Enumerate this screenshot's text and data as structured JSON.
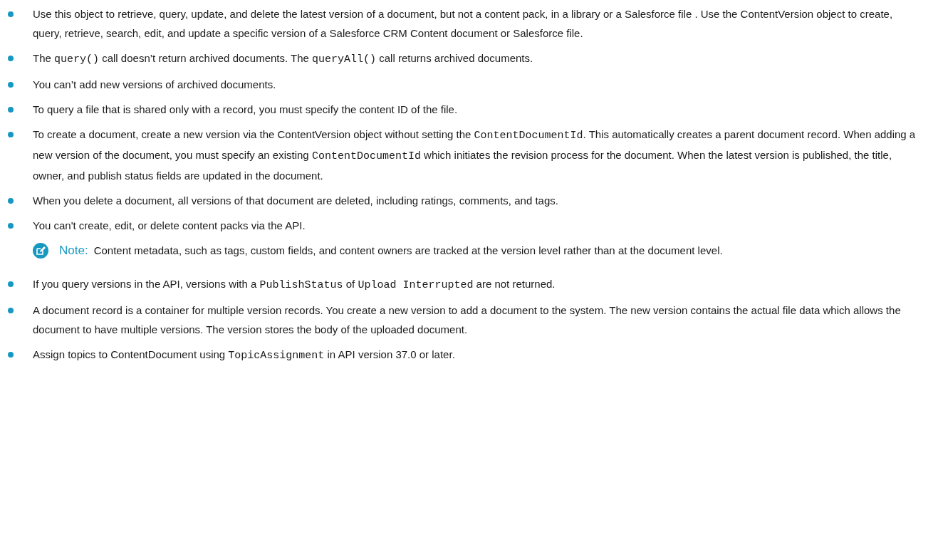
{
  "items": [
    {
      "kind": "bullet",
      "parts": [
        {
          "kind": "text",
          "text": "Use this object to retrieve, query, update, and delete the latest version of a document, but not a content pack, in a library or a Salesforce file . Use the ContentVersion object to create, query, retrieve, search, edit, and update a specific version of a Salesforce CRM Content document or Salesforce file."
        }
      ]
    },
    {
      "kind": "bullet",
      "parts": [
        {
          "kind": "text",
          "text": "The "
        },
        {
          "kind": "code",
          "text": "query()"
        },
        {
          "kind": "text",
          "text": " call doesn’t return archived documents. The "
        },
        {
          "kind": "code",
          "text": "queryAll()"
        },
        {
          "kind": "text",
          "text": " call returns archived documents."
        }
      ]
    },
    {
      "kind": "bullet",
      "parts": [
        {
          "kind": "text",
          "text": "You can’t add new versions of archived documents."
        }
      ]
    },
    {
      "kind": "bullet",
      "parts": [
        {
          "kind": "text",
          "text": "To query a file that is shared only with a record, you must specify the content ID of the file."
        }
      ]
    },
    {
      "kind": "bullet",
      "parts": [
        {
          "kind": "text",
          "text": "To create a document, create a new version via the ContentVersion object without setting the "
        },
        {
          "kind": "code",
          "text": "ContentDocumentId"
        },
        {
          "kind": "text",
          "text": ". This automatically creates a parent document record. When adding a new version of the document, you must specify an existing "
        },
        {
          "kind": "code",
          "text": "ContentDocumentId"
        },
        {
          "kind": "text",
          "text": " which initiates the revision process for the document. When the latest version is published, the title, owner, and publish status fields are updated in the document."
        }
      ]
    },
    {
      "kind": "bullet",
      "parts": [
        {
          "kind": "text",
          "text": "When you delete a document, all versions of that document are deleted, including ratings, comments, and tags."
        }
      ]
    },
    {
      "kind": "bullet",
      "parts": [
        {
          "kind": "text",
          "text": "You can't create, edit, or delete content packs via the API."
        }
      ]
    },
    {
      "kind": "note",
      "label": "Note:",
      "text": "Content metadata, such as tags, custom fields, and content owners are tracked at the version level rather than at the document level."
    },
    {
      "kind": "bullet",
      "parts": [
        {
          "kind": "text",
          "text": "If you query versions in the API, versions with a "
        },
        {
          "kind": "code",
          "text": "PublishStatus"
        },
        {
          "kind": "text",
          "text": " of "
        },
        {
          "kind": "code",
          "text": "Upload Interrupted"
        },
        {
          "kind": "text",
          "text": " are not returned."
        }
      ]
    },
    {
      "kind": "bullet",
      "parts": [
        {
          "kind": "text",
          "text": "A document record is a container for multiple version records. You create a new version to add a document to the system. The new version contains the actual file data which allows the document to have multiple versions. The version stores the body of the uploaded document."
        }
      ]
    },
    {
      "kind": "bullet",
      "parts": [
        {
          "kind": "text",
          "text": "Assign topics to ContentDocument using "
        },
        {
          "kind": "code",
          "text": "TopicAssignment"
        },
        {
          "kind": "text",
          "text": " in API version 37.0 or later."
        }
      ]
    }
  ]
}
